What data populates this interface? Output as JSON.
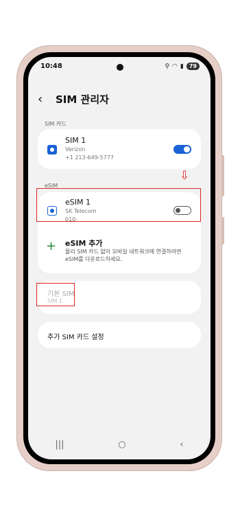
{
  "status_bar": {
    "time": "10:48",
    "battery": "79",
    "icons": [
      "location-icon",
      "wifi-icon",
      "signal-icon"
    ]
  },
  "header": {
    "back_icon": "‹",
    "title": "SIM 관리자"
  },
  "sections": {
    "sim_card": "SIM 카드",
    "esim": "eSIM"
  },
  "sim1": {
    "title": "SIM 1",
    "carrier": "Verizon",
    "number": "+1 213-649-5777",
    "enabled": true
  },
  "esim1": {
    "title": "eSIM 1",
    "carrier": "SK Telecom",
    "number": "010-",
    "enabled": false
  },
  "add_esim": {
    "title": "eSIM 추가",
    "description_line1": "물리 SIM 카드 없이 모바일 네트워크에 연결하려면",
    "description_line2": "eSIM를 다운로드하세요."
  },
  "default_sim": {
    "title": "기본 SIM",
    "value": "SIM 1"
  },
  "additional_settings": {
    "title": "추가 SIM 카드 설정"
  },
  "nav": {
    "recent": "|||",
    "home": "○",
    "back": "‹"
  },
  "colors": {
    "accent": "#1a62d6",
    "highlight": "#e12626",
    "plus": "#2a8a3a"
  },
  "annotation": {
    "arrow": "⇩"
  }
}
